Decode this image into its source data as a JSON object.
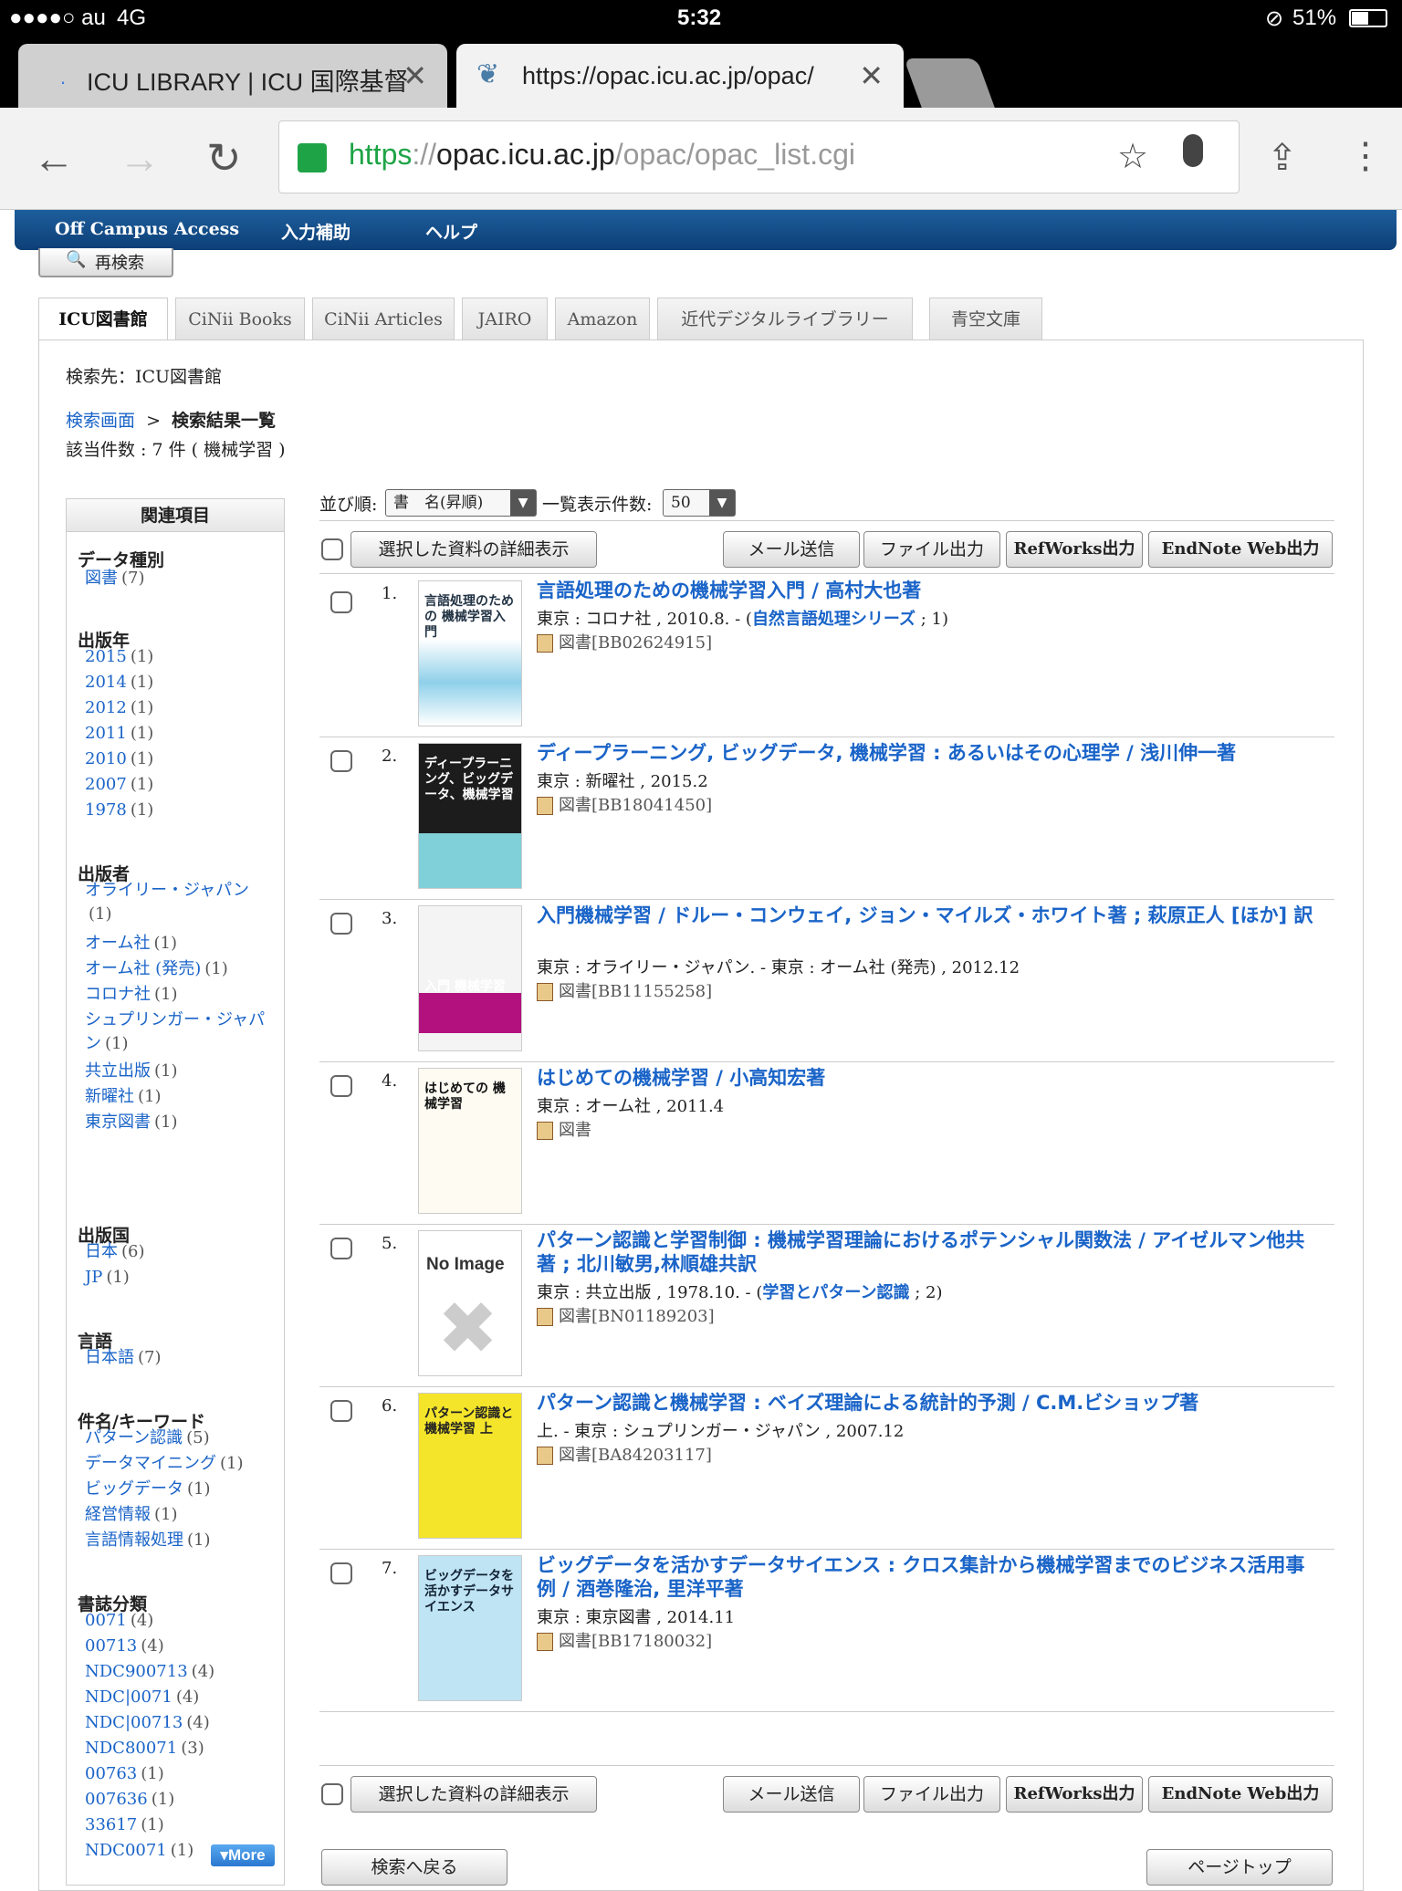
{
  "statusbar": {
    "carrier": "●●●●○ au",
    "network": "4G",
    "time": "5:32",
    "battery": "51%"
  },
  "browser": {
    "tabs": [
      {
        "title": "ICU LIBRARY | ICU 国際基督"
      },
      {
        "title": "https://opac.icu.ac.jp/opac/"
      }
    ],
    "url_scheme": "https",
    "url_sep": "://",
    "url_domain": "opac.icu.ac.jp",
    "url_path": "/opac/opac_list.cgi"
  },
  "nav": {
    "items": [
      "Off Campus Access",
      "入力補助",
      "ヘルプ"
    ]
  },
  "research_button": "再検索",
  "source_tabs": [
    "ICU図書館",
    "CiNii Books",
    "CiNii Articles",
    "JAIRO",
    "Amazon",
    "近代デジタルライブラリー",
    "青空文庫"
  ],
  "search_target": "検索先：ICU図書館",
  "breadcrumb": {
    "link": "検索画面",
    "sep": ">",
    "current": "検索結果一覧"
  },
  "hit_count": "該当件数 : 7 件 ( 機械学習 )",
  "sidebar": {
    "title": "関連項目",
    "sections": [
      {
        "heading": "データ種別",
        "items": [
          {
            "label": "図書",
            "count": "(7)"
          }
        ]
      },
      {
        "heading": "出版年",
        "items": [
          {
            "label": "2015",
            "count": "(1)"
          },
          {
            "label": "2014",
            "count": "(1)"
          },
          {
            "label": "2012",
            "count": "(1)"
          },
          {
            "label": "2011",
            "count": "(1)"
          },
          {
            "label": "2010",
            "count": "(1)"
          },
          {
            "label": "2007",
            "count": "(1)"
          },
          {
            "label": "1978",
            "count": "(1)"
          }
        ]
      },
      {
        "heading": "出版者",
        "items": [
          {
            "label": "オライリー・ジャパン",
            "count": "(1)"
          },
          {
            "label": "オーム社",
            "count": "(1)"
          },
          {
            "label": "オーム社 (発売)",
            "count": "(1)"
          },
          {
            "label": "コロナ社",
            "count": "(1)"
          },
          {
            "label": "シュプリンガー・ジャパン",
            "count": "(1)"
          },
          {
            "label": "共立出版",
            "count": "(1)"
          },
          {
            "label": "新曜社",
            "count": "(1)"
          },
          {
            "label": "東京図書",
            "count": "(1)"
          }
        ]
      },
      {
        "heading": "出版国",
        "items": [
          {
            "label": "日本",
            "count": "(6)"
          },
          {
            "label": "JP",
            "count": "(1)"
          }
        ]
      },
      {
        "heading": "言語",
        "items": [
          {
            "label": "日本語",
            "count": "(7)"
          }
        ]
      },
      {
        "heading": "件名/キーワード",
        "items": [
          {
            "label": "パターン認識",
            "count": "(5)"
          },
          {
            "label": "データマイニング",
            "count": "(1)"
          },
          {
            "label": "ビッグデータ",
            "count": "(1)"
          },
          {
            "label": "経営情報",
            "count": "(1)"
          },
          {
            "label": "言語情報処理",
            "count": "(1)"
          }
        ]
      },
      {
        "heading": "書誌分類",
        "items": [
          {
            "label": "0071",
            "count": "(4)"
          },
          {
            "label": "00713",
            "count": "(4)"
          },
          {
            "label": "NDC900713",
            "count": "(4)"
          },
          {
            "label": "NDC|0071",
            "count": "(4)"
          },
          {
            "label": "NDC|00713",
            "count": "(4)"
          },
          {
            "label": "NDC80071",
            "count": "(3)"
          },
          {
            "label": "00763",
            "count": "(1)"
          },
          {
            "label": "007636",
            "count": "(1)"
          },
          {
            "label": "33617",
            "count": "(1)"
          },
          {
            "label": "NDC0071",
            "count": "(1)"
          }
        ]
      }
    ],
    "more": "More"
  },
  "controls": {
    "sort_label": "並び順:",
    "sort_value": "書　名(昇順)",
    "perpage_label": "一覧表示件数:",
    "perpage_value": "50"
  },
  "actions": {
    "detail": "選択した資料の詳細表示",
    "mail": "メール送信",
    "file": "ファイル出力",
    "refworks": "RefWorks出力",
    "endnote": "EndNote Web出力"
  },
  "results": [
    {
      "num": "1.",
      "title": "言語処理のための機械学習入門 / 高村大也著",
      "pub_pre": "東京 : コロナ社 , 2010.8. - (",
      "series": "自然言語処理シリーズ",
      "pub_post": " ; 1)",
      "meta": "図書[BB02624915]"
    },
    {
      "num": "2.",
      "title": "ディープラーニング, ビッグデータ, 機械学習 : あるいはその心理学 / 浅川伸一著",
      "pub_pre": "東京 : 新曜社 , 2015.2",
      "series": "",
      "pub_post": "",
      "meta": "図書[BB18041450]"
    },
    {
      "num": "3.",
      "title": "入門機械学習 / ドルー・コンウェイ, ジョン・マイルズ・ホワイト著 ; 萩原正人 [ほか] 訳",
      "pub_pre": "東京 : オライリー・ジャパン. - 東京 : オーム社 (発売) , 2012.12",
      "series": "",
      "pub_post": "",
      "meta": "図書[BB11155258]"
    },
    {
      "num": "4.",
      "title": "はじめての機械学習 / 小高知宏著",
      "pub_pre": "東京 : オーム社 , 2011.4",
      "series": "",
      "pub_post": "",
      "meta": "図書"
    },
    {
      "num": "5.",
      "title": "パターン認識と学習制御 : 機械学習理論におけるポテンシャル関数法 / アイゼルマン他共著 ; 北川敏男,林順雄共訳",
      "pub_pre": "東京 : 共立出版 , 1978.10. - (",
      "series": "学習とパターン認識",
      "pub_post": " ; 2)",
      "meta": "図書[BN01189203]"
    },
    {
      "num": "6.",
      "title": "パターン認識と機械学習 : ベイズ理論による統計的予測 / C.M.ビショップ著",
      "pub_pre": "上. - 東京 : シュプリンガー・ジャパン , 2007.12",
      "series": "",
      "pub_post": "",
      "meta": "図書[BA84203117]"
    },
    {
      "num": "7.",
      "title": "ビッグデータを活かすデータサイエンス : クロス集計から機械学習までのビジネス活用事例 / 酒巻隆治, 里洋平著",
      "pub_pre": "東京 : 東京図書 , 2014.11",
      "series": "",
      "pub_post": "",
      "meta": "図書[BB17180032]"
    }
  ],
  "covers": {
    "c1": "言語処理のための 機械学習入門",
    "c2": "ディープラーニング、ビッグデータ、機械学習",
    "c3": "入門 機械学習",
    "c4": "はじめての 機械学習",
    "c5": "No Image",
    "c6": "パターン認識と 機械学習 上",
    "c7": "ビッグデータを 活かすデータサイエンス"
  },
  "footer": {
    "back": "検索へ戻る",
    "top": "ページトップ"
  }
}
